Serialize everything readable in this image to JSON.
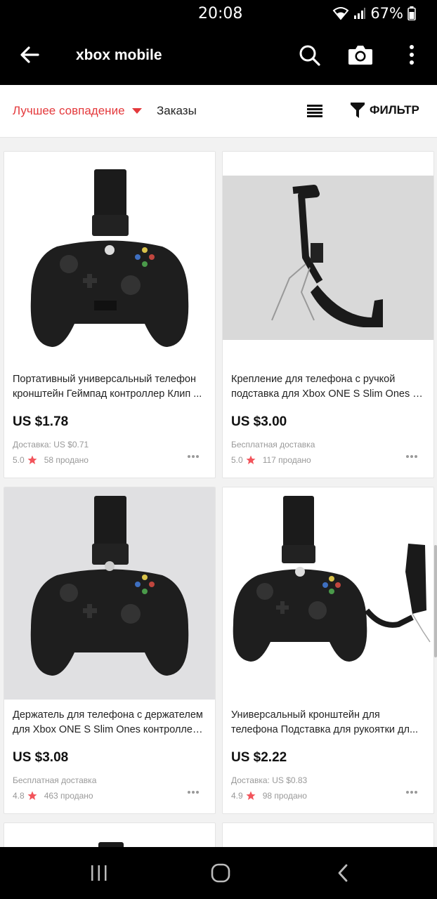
{
  "status_bar": {
    "time": "20:08",
    "battery": "67%"
  },
  "app_bar": {
    "query": "xbox mobile"
  },
  "sort_bar": {
    "best_match": "Лучшее совпадение",
    "orders": "Заказы",
    "filter": "ФИЛЬТР"
  },
  "colors": {
    "accent": "#e4393c",
    "star": "#f2545b",
    "bar": "#000000"
  },
  "products": [
    {
      "title_line1": "Портативный универсальный телефон",
      "title_line2": "кронштейн Геймпад контроллер Клип ...",
      "price": "US $1.78",
      "shipping": "Доставка: US $0.71",
      "rating": "5.0",
      "sold": "58 продано"
    },
    {
      "title_line1": "Крепление для телефона с ручкой",
      "title_line2": "подставка для Xbox ONE S Slim Ones и...",
      "price": "US $3.00",
      "shipping": "Бесплатная доставка",
      "rating": "5.0",
      "sold": "117 продано"
    },
    {
      "title_line1": "Держатель для телефона с держателем",
      "title_line2": "для Xbox ONE S Slim Ones контроллер ...",
      "price": "US $3.08",
      "shipping": "Бесплатная доставка",
      "rating": "4.8",
      "sold": "463 продано"
    },
    {
      "title_line1": "Универсальный кронштейн для",
      "title_line2": "телефона Подставка для рукоятки дл...",
      "price": "US $2.22",
      "shipping": "Доставка: US $0.83",
      "rating": "4.9",
      "sold": "98 продано"
    }
  ]
}
